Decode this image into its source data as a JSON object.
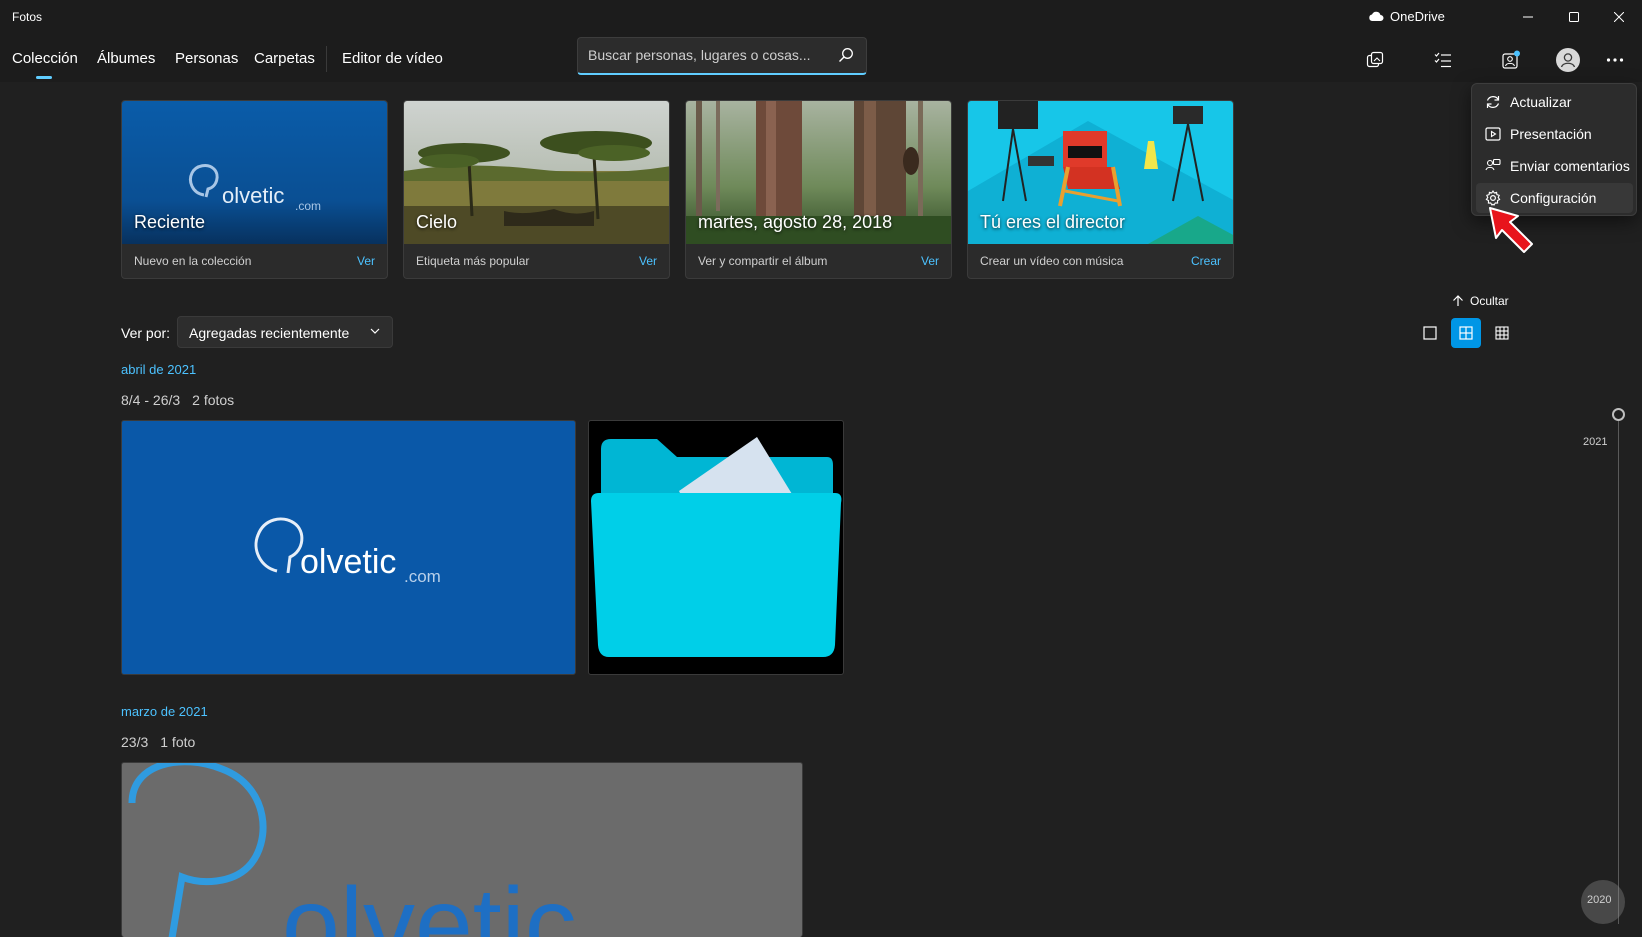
{
  "window": {
    "title": "Fotos",
    "onedrive_label": "OneDrive"
  },
  "nav": {
    "tabs": [
      {
        "label": "Colección",
        "active": true
      },
      {
        "label": "Álbumes"
      },
      {
        "label": "Personas"
      },
      {
        "label": "Carpetas"
      },
      {
        "label": "Editor de vídeo"
      }
    ],
    "search_placeholder": "Buscar personas, lugares o cosas..."
  },
  "cards": [
    {
      "title": "Reciente",
      "subtitle": "Nuevo en la colección",
      "action": "Ver",
      "logo_text": "olvetic",
      "logo_suffix": ".com"
    },
    {
      "title": "Cielo",
      "subtitle": "Etiqueta más popular",
      "action": "Ver"
    },
    {
      "title": "martes, agosto 28, 2018",
      "subtitle": "Ver y compartir el álbum",
      "action": "Ver"
    },
    {
      "title": "Tú eres el director",
      "subtitle": "Crear un vídeo con música",
      "action": "Crear"
    }
  ],
  "sort": {
    "label": "Ver por:",
    "value": "Agregadas recientemente"
  },
  "hide_label": "Ocultar",
  "groups": [
    {
      "date": "abril de 2021",
      "range": "8/4 - 26/3",
      "count": "2 fotos"
    },
    {
      "date": "marzo de 2021",
      "range": "23/3",
      "count": "1 foto"
    }
  ],
  "photo_logo": {
    "text": "olvetic",
    "suffix": ".com"
  },
  "big_logo_text": "olvetic",
  "timeline": {
    "years": [
      "2021",
      "2020"
    ]
  },
  "menu": {
    "items": [
      {
        "label": "Actualizar",
        "icon": "refresh-icon"
      },
      {
        "label": "Presentación",
        "icon": "slideshow-icon"
      },
      {
        "label": "Enviar comentarios",
        "icon": "feedback-icon"
      },
      {
        "label": "Configuración",
        "icon": "gear-icon"
      }
    ]
  },
  "colors": {
    "accent": "#60cdff",
    "link": "#4cc2ff",
    "brand_blue": "#0a5aa8",
    "folder": "#00cfe8",
    "pointer": "#e8141c"
  }
}
